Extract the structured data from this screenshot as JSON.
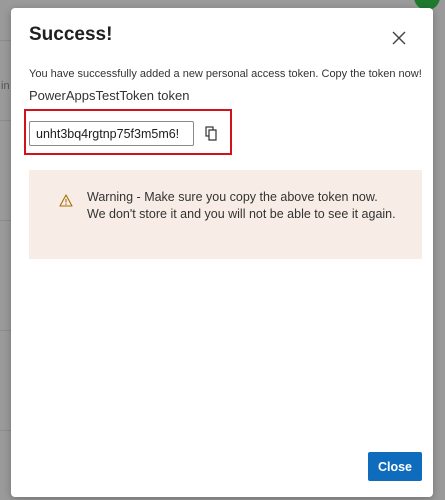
{
  "dialog": {
    "title": "Success!",
    "message": "You have successfully added a new personal access token. Copy the token now!",
    "token_name": "PowerAppsTestToken token",
    "token_value": "unht3bq4rgtnp75f3m5m6!",
    "warning": {
      "text": "Warning - Make sure you copy the above token now. We don't store it and you will not be able to see it again."
    },
    "close_label": "Close"
  },
  "background": {
    "fragment_text": "in"
  },
  "icons": {
    "close": "close-icon",
    "copy": "copy-icon",
    "warning": "warning-icon"
  },
  "colors": {
    "primary_button": "#0f6cbd",
    "highlight_border": "#d0131b",
    "warning_background": "#f8ede6",
    "warning_icon": "#a37000"
  }
}
